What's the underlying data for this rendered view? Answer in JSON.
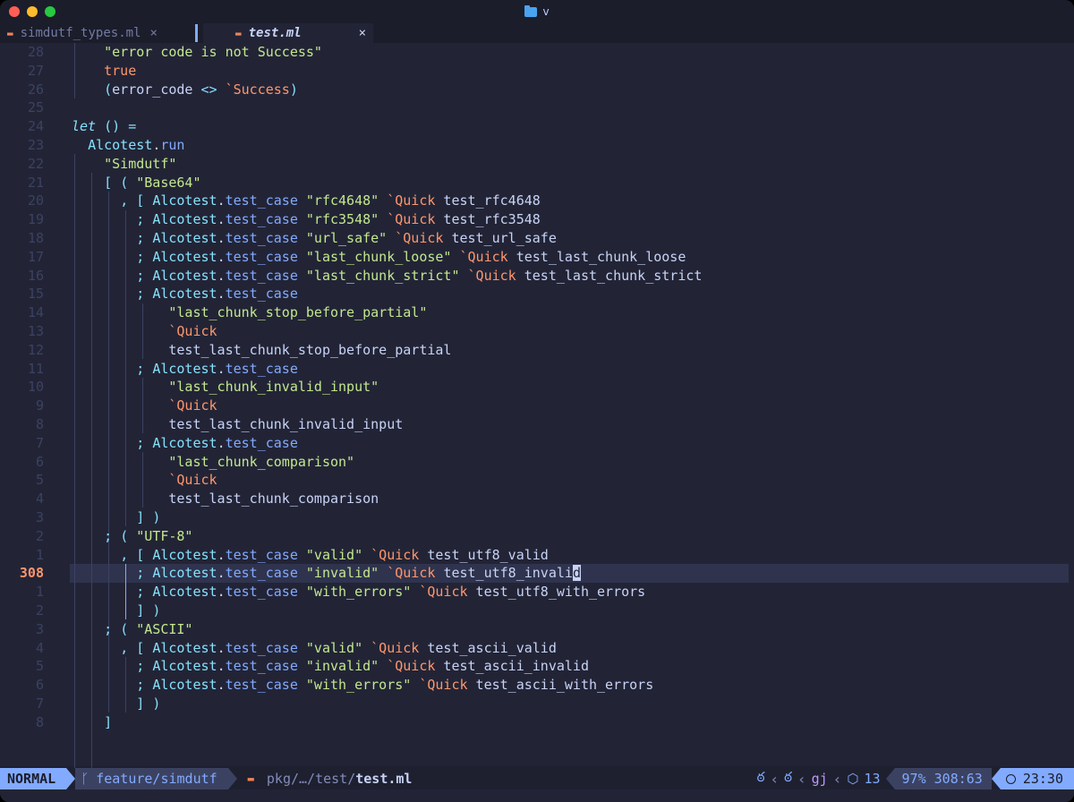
{
  "window": {
    "title": "v"
  },
  "tabs": [
    {
      "label": "simdutf_types.ml",
      "close": "×"
    },
    {
      "label": "test.ml",
      "close": "×"
    }
  ],
  "editor": {
    "lines": [
      {
        "num": "28",
        "html": "    <span class=\"str\">\"error code is not Success\"</span>"
      },
      {
        "num": "27",
        "html": "    <span class=\"kw\">true</span>"
      },
      {
        "num": "26",
        "html": "    <span class=\"pun\">(</span>error_code <span class=\"op\">&lt;&gt;</span> <span class=\"pv\">`Success</span><span class=\"pun\">)</span>"
      },
      {
        "num": "25",
        "html": ""
      },
      {
        "num": "24",
        "html": "<span class=\"kwi\">let</span> <span class=\"pun\">()</span> <span class=\"op\">=</span>"
      },
      {
        "num": "23",
        "html": "  <span class=\"mod\">Alcotest</span>.<span class=\"fn\">run</span>"
      },
      {
        "num": "22",
        "html": "    <span class=\"str\">\"Simdutf\"</span>"
      },
      {
        "num": "21",
        "html": "    <span class=\"pun\">[</span> <span class=\"pun\">(</span> <span class=\"str\">\"Base64\"</span>"
      },
      {
        "num": "20",
        "html": "      <span class=\"pun\">,</span> <span class=\"pun\">[</span> <span class=\"mod\">Alcotest</span>.<span class=\"fn\">test_case</span> <span class=\"str\">\"rfc4648\"</span> <span class=\"pv\">`Quick</span> test_rfc4648"
      },
      {
        "num": "19",
        "html": "        <span class=\"pun\">;</span> <span class=\"mod\">Alcotest</span>.<span class=\"fn\">test_case</span> <span class=\"str\">\"rfc3548\"</span> <span class=\"pv\">`Quick</span> test_rfc3548"
      },
      {
        "num": "18",
        "html": "        <span class=\"pun\">;</span> <span class=\"mod\">Alcotest</span>.<span class=\"fn\">test_case</span> <span class=\"str\">\"url_safe\"</span> <span class=\"pv\">`Quick</span> test_url_safe"
      },
      {
        "num": "17",
        "html": "        <span class=\"pun\">;</span> <span class=\"mod\">Alcotest</span>.<span class=\"fn\">test_case</span> <span class=\"str\">\"last_chunk_loose\"</span> <span class=\"pv\">`Quick</span> test_last_chunk_loose"
      },
      {
        "num": "16",
        "html": "        <span class=\"pun\">;</span> <span class=\"mod\">Alcotest</span>.<span class=\"fn\">test_case</span> <span class=\"str\">\"last_chunk_strict\"</span> <span class=\"pv\">`Quick</span> test_last_chunk_strict"
      },
      {
        "num": "15",
        "html": "        <span class=\"pun\">;</span> <span class=\"mod\">Alcotest</span>.<span class=\"fn\">test_case</span>"
      },
      {
        "num": "14",
        "html": "            <span class=\"str\">\"last_chunk_stop_before_partial\"</span>"
      },
      {
        "num": "13",
        "html": "            <span class=\"pv\">`Quick</span>"
      },
      {
        "num": "12",
        "html": "            test_last_chunk_stop_before_partial"
      },
      {
        "num": "11",
        "html": "        <span class=\"pun\">;</span> <span class=\"mod\">Alcotest</span>.<span class=\"fn\">test_case</span>"
      },
      {
        "num": "10",
        "html": "            <span class=\"str\">\"last_chunk_invalid_input\"</span>"
      },
      {
        "num": "9",
        "html": "            <span class=\"pv\">`Quick</span>"
      },
      {
        "num": "8",
        "html": "            test_last_chunk_invalid_input"
      },
      {
        "num": "7",
        "html": "        <span class=\"pun\">;</span> <span class=\"mod\">Alcotest</span>.<span class=\"fn\">test_case</span>"
      },
      {
        "num": "6",
        "html": "            <span class=\"str\">\"last_chunk_comparison\"</span>"
      },
      {
        "num": "5",
        "html": "            <span class=\"pv\">`Quick</span>"
      },
      {
        "num": "4",
        "html": "            test_last_chunk_comparison"
      },
      {
        "num": "3",
        "html": "        <span class=\"pun\">]</span> <span class=\"pun\">)</span>"
      },
      {
        "num": "2",
        "html": "    <span class=\"pun\">;</span> <span class=\"pun\">(</span> <span class=\"str\">\"UTF-8\"</span>"
      },
      {
        "num": "1",
        "html": "      <span class=\"pun\">,</span> <span class=\"pun\">[</span> <span class=\"mod\">Alcotest</span>.<span class=\"fn\">test_case</span> <span class=\"str\">\"valid\"</span> <span class=\"pv\">`Quick</span> test_utf8_valid"
      },
      {
        "num": "308",
        "current": true,
        "html": "        <span class=\"pun\">;</span> <span class=\"mod\">Alcotest</span>.<span class=\"fn\">test_case</span> <span class=\"str\">\"invalid\"</span> <span class=\"pv\">`Quick</span> <span class=\"hl\">test_utf8_invali</span><span class=\"cursor\">d</span>"
      },
      {
        "num": "1",
        "html": "        <span class=\"pun\">;</span> <span class=\"mod\">Alcotest</span>.<span class=\"fn\">test_case</span> <span class=\"str\">\"with_errors\"</span> <span class=\"pv\">`Quick</span> test_utf8_with_errors"
      },
      {
        "num": "2",
        "html": "        <span class=\"pun\">]</span> <span class=\"pun\">)</span>"
      },
      {
        "num": "3",
        "html": "    <span class=\"pun\">;</span> <span class=\"pun\">(</span> <span class=\"str\">\"ASCII\"</span>"
      },
      {
        "num": "4",
        "html": "      <span class=\"pun\">,</span> <span class=\"pun\">[</span> <span class=\"mod\">Alcotest</span>.<span class=\"fn\">test_case</span> <span class=\"str\">\"valid\"</span> <span class=\"pv\">`Quick</span> test_ascii_valid"
      },
      {
        "num": "5",
        "html": "        <span class=\"pun\">;</span> <span class=\"mod\">Alcotest</span>.<span class=\"fn\">test_case</span> <span class=\"str\">\"invalid\"</span> <span class=\"pv\">`Quick</span> test_ascii_invalid"
      },
      {
        "num": "6",
        "html": "        <span class=\"pun\">;</span> <span class=\"mod\">Alcotest</span>.<span class=\"fn\">test_case</span> <span class=\"str\">\"with_errors\"</span> <span class=\"pv\">`Quick</span> test_ascii_with_errors"
      },
      {
        "num": "7",
        "html": "        <span class=\"pun\">]</span> <span class=\"pun\">)</span>"
      },
      {
        "num": "8",
        "html": "    <span class=\"pun\">]</span>"
      }
    ]
  },
  "statusline": {
    "mode": "NORMAL",
    "branch": "feature/simdutf",
    "path_prefix": "pkg/…/test/",
    "file": "test.ml",
    "lsp_label": "gj",
    "diag_count": "13",
    "progress": "97%",
    "position": "308:63",
    "time": "23:30"
  },
  "colors": {
    "accent": "#82aaff",
    "background": "#222436",
    "string": "#c3e88d",
    "keyword": "#ff966c"
  }
}
